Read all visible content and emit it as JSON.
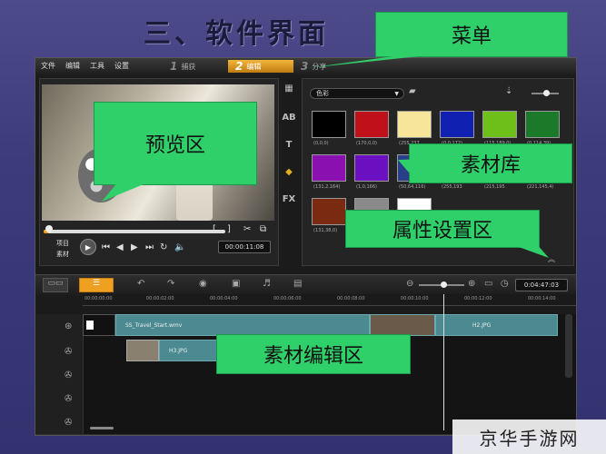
{
  "slide_title": "三、软件界面",
  "menu": {
    "items": [
      "文件",
      "编辑",
      "工具",
      "设置"
    ],
    "steps": [
      {
        "num": "1",
        "label": "捕获"
      },
      {
        "num": "2",
        "label": "编辑"
      },
      {
        "num": "3",
        "label": "分享"
      }
    ]
  },
  "preview": {
    "project_label": "项目",
    "clip_label": "素材",
    "timecode": "00:00:11:08"
  },
  "side_tools": [
    "AB",
    "T",
    "FX"
  ],
  "library": {
    "category": "色彩",
    "swatches": [
      {
        "color": "#000000",
        "label": "(0,0,0)"
      },
      {
        "color": "#c0101a",
        "label": "(170,0,0)"
      },
      {
        "color": "#f7e69a",
        "label": "(255,237"
      },
      {
        "color": "#1020b0",
        "label": "(0,0,172)"
      },
      {
        "color": "#6fbf1a",
        "label": "(115,189,0)"
      },
      {
        "color": "#1a7a2a",
        "label": "(0,114,39)"
      },
      {
        "color": "#8a10b0",
        "label": "(131,2,164)"
      },
      {
        "color": "#6a10c0",
        "label": "(1,0,166)"
      },
      {
        "color": "#2a3f8a",
        "label": "(50,64,116)"
      },
      {
        "color": "#5a4aa0",
        "label": "(255,193"
      },
      {
        "color": "#8a1060",
        "label": "(215,195"
      },
      {
        "color": "#5a1010",
        "label": "(221,145,4)"
      },
      {
        "color": "#7a2a10",
        "label": "(131,38,0)"
      },
      {
        "color": "#8a8a8a",
        "label": "(165,165"
      },
      {
        "color": "#ffffff",
        "label": "(255,255"
      }
    ]
  },
  "timeline": {
    "toolbar_timecode": "0:04:47:03",
    "ruler": [
      "00:00:00:00",
      "00:00:02:00",
      "00:00:04:00",
      "00:00:06:00",
      "00:00:08:00",
      "00:00:10:00",
      "00:00:12:00",
      "00:00:14:00"
    ],
    "clips": {
      "video_main": "SS_Travel_Start.wmv",
      "video_end": "H2.JPG",
      "overlay": "H3.JPG"
    }
  },
  "callouts": {
    "menu": "菜单",
    "preview": "预览区",
    "library": "素材库",
    "properties": "属性设置区",
    "editing": "素材编辑区"
  },
  "watermark": "京华手游网"
}
